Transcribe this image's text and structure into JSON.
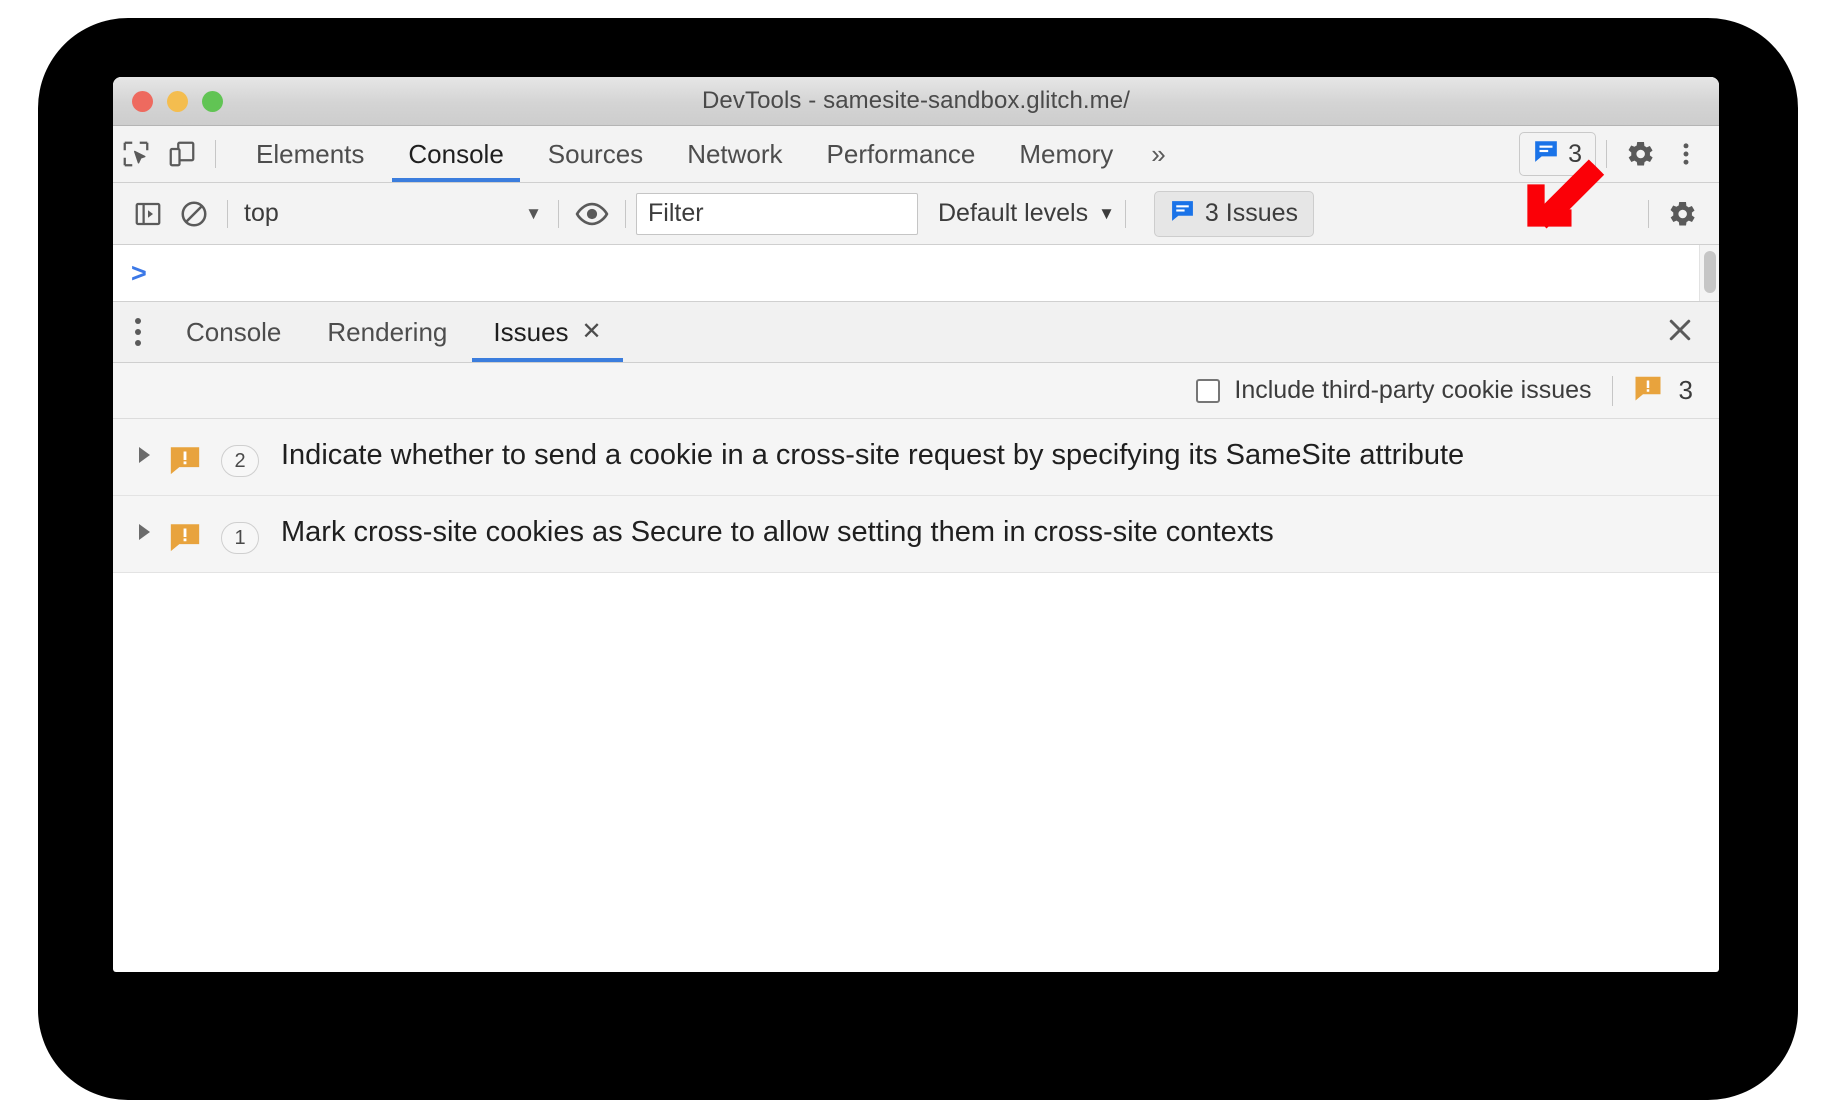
{
  "window": {
    "title": "DevTools - samesite-sandbox.glitch.me/",
    "traffic_lights": [
      "close",
      "minimize",
      "zoom"
    ],
    "colors": {
      "close": "#ee6a5f",
      "minimize": "#f4bd4f",
      "zoom": "#61c454",
      "accent": "#3b7ddd",
      "issue_blue": "#3b78e7",
      "warning_orange": "#e8a33d",
      "annotation_red": "#fb0007"
    }
  },
  "main_toolbar": {
    "inspect_icon": "inspect-element-icon",
    "device_icon": "device-toolbar-icon",
    "tabs": [
      {
        "label": "Elements",
        "active": false
      },
      {
        "label": "Console",
        "active": true
      },
      {
        "label": "Sources",
        "active": false
      },
      {
        "label": "Network",
        "active": false
      },
      {
        "label": "Performance",
        "active": false
      },
      {
        "label": "Memory",
        "active": false
      }
    ],
    "more_tabs": "»",
    "issues_chip": {
      "icon": "issues-message-icon",
      "count": "3"
    },
    "settings_icon": "gear-icon",
    "more_icon": "kebab-menu-icon"
  },
  "console_toolbar": {
    "sidebar_icon": "console-sidebar-icon",
    "clear_icon": "clear-console-icon",
    "context": {
      "value": "top",
      "caret": "▼"
    },
    "eye_icon": "live-expression-icon",
    "filter": {
      "value": "",
      "placeholder": "Filter"
    },
    "levels": {
      "label": "Default levels",
      "caret": "▼"
    },
    "issues_button": {
      "icon": "issues-message-icon",
      "label": "3 Issues"
    },
    "settings_icon": "gear-icon"
  },
  "console_prompt": {
    "prompt": ">",
    "value": ""
  },
  "drawer": {
    "menu_icon": "kebab-menu-icon",
    "tabs": [
      {
        "label": "Console",
        "active": false,
        "closable": false
      },
      {
        "label": "Rendering",
        "active": false,
        "closable": false
      },
      {
        "label": "Issues",
        "active": true,
        "closable": true,
        "close_glyph": "✕"
      }
    ],
    "close_glyph": "✕"
  },
  "issues_panel": {
    "checkbox": {
      "label": "Include third-party cookie issues",
      "checked": false
    },
    "summary": {
      "icon": "warning-message-icon",
      "count": "3"
    },
    "rows": [
      {
        "expander": "▶",
        "icon": "warning-message-icon",
        "count": "2",
        "text": "Indicate whether to send a cookie in a cross-site request by specifying its SameSite attribute"
      },
      {
        "expander": "▶",
        "icon": "warning-message-icon",
        "count": "1",
        "text": "Mark cross-site cookies as Secure to allow setting them in cross-site contexts"
      }
    ]
  },
  "annotation": {
    "arrow": "red-arrow-pointing-down-left"
  }
}
